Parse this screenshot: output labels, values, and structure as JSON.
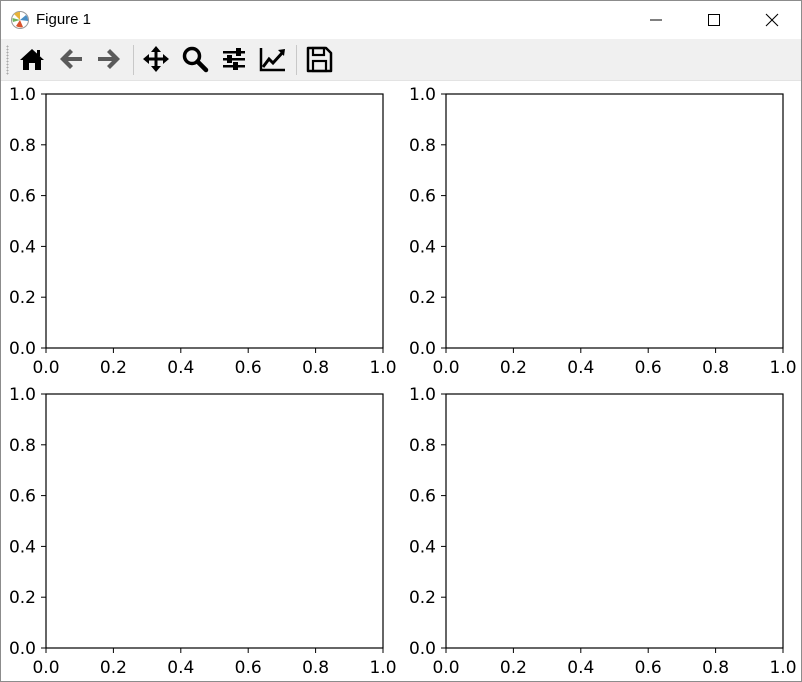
{
  "window": {
    "title": "Figure 1"
  },
  "toolbar": {
    "buttons": [
      {
        "name": "home-button",
        "icon": "home-icon"
      },
      {
        "name": "back-button",
        "icon": "arrow-left-icon"
      },
      {
        "name": "forward-button",
        "icon": "arrow-right-icon"
      },
      {
        "name": "pan-button",
        "icon": "move-arrows-icon"
      },
      {
        "name": "zoom-button",
        "icon": "magnifier-icon"
      },
      {
        "name": "configure-subplots-button",
        "icon": "sliders-icon"
      },
      {
        "name": "edit-axis-button",
        "icon": "line-chart-icon"
      },
      {
        "name": "save-button",
        "icon": "floppy-disk-icon"
      }
    ]
  },
  "colors": {
    "toolbar_bg": "#f0f0f0",
    "icon_active": "#000000",
    "icon_disabled": "#5a5a5a",
    "axes_edge": "#000000"
  },
  "chart_data": [
    {
      "type": "line",
      "title": "",
      "xlabel": "",
      "ylabel": "",
      "xlim": [
        0.0,
        1.0
      ],
      "ylim": [
        0.0,
        1.0
      ],
      "xticks": [
        "0.0",
        "0.2",
        "0.4",
        "0.6",
        "0.8",
        "1.0"
      ],
      "yticks": [
        "0.0",
        "0.2",
        "0.4",
        "0.6",
        "0.8",
        "1.0"
      ],
      "series": [],
      "grid": false
    },
    {
      "type": "line",
      "title": "",
      "xlabel": "",
      "ylabel": "",
      "xlim": [
        0.0,
        1.0
      ],
      "ylim": [
        0.0,
        1.0
      ],
      "xticks": [
        "0.0",
        "0.2",
        "0.4",
        "0.6",
        "0.8",
        "1.0"
      ],
      "yticks": [
        "0.0",
        "0.2",
        "0.4",
        "0.6",
        "0.8",
        "1.0"
      ],
      "series": [],
      "grid": false
    },
    {
      "type": "line",
      "title": "",
      "xlabel": "",
      "ylabel": "",
      "xlim": [
        0.0,
        1.0
      ],
      "ylim": [
        0.0,
        1.0
      ],
      "xticks": [
        "0.0",
        "0.2",
        "0.4",
        "0.6",
        "0.8",
        "1.0"
      ],
      "yticks": [
        "0.0",
        "0.2",
        "0.4",
        "0.6",
        "0.8",
        "1.0"
      ],
      "series": [],
      "grid": false
    },
    {
      "type": "line",
      "title": "",
      "xlabel": "",
      "ylabel": "",
      "xlim": [
        0.0,
        1.0
      ],
      "ylim": [
        0.0,
        1.0
      ],
      "xticks": [
        "0.0",
        "0.2",
        "0.4",
        "0.6",
        "0.8",
        "1.0"
      ],
      "yticks": [
        "0.0",
        "0.2",
        "0.4",
        "0.6",
        "0.8",
        "1.0"
      ],
      "series": [],
      "grid": false
    }
  ]
}
